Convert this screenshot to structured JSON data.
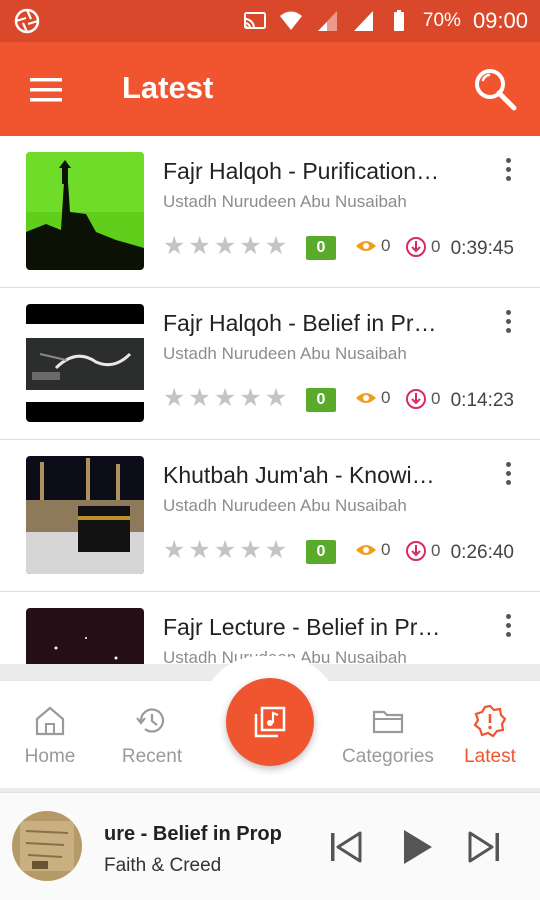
{
  "status_bar": {
    "battery": "70%",
    "time": "09:00"
  },
  "appbar": {
    "title": "Latest"
  },
  "items": [
    {
      "title": "Fajr Halqoh - Purification…",
      "author": "Ustadh Nurudeen Abu Nusaibah",
      "rating_badge": "0",
      "views": "0",
      "downloads": "0",
      "duration": "0:39:45"
    },
    {
      "title": "Fajr Halqoh - Belief in Pr…",
      "author": "Ustadh Nurudeen Abu Nusaibah",
      "rating_badge": "0",
      "views": "0",
      "downloads": "0",
      "duration": "0:14:23"
    },
    {
      "title": "Khutbah Jum'ah - Knowi…",
      "author": "Ustadh Nurudeen Abu Nusaibah",
      "rating_badge": "0",
      "views": "0",
      "downloads": "0",
      "duration": "0:26:40"
    },
    {
      "title": "Fajr Lecture - Belief in Pr…",
      "author": "Ustadh Nurudeen Abu Nusaibah"
    }
  ],
  "nav": {
    "home": "Home",
    "recent": "Recent",
    "categories": "Categories",
    "latest": "Latest"
  },
  "player": {
    "title": "ure - Belief in Prop",
    "subtitle": "Faith & Creed"
  },
  "colors": {
    "accent": "#f0552f",
    "status_bar": "#d9482b",
    "badge_green": "#5aab2c",
    "views_orange": "#f0a020",
    "downloads_pink": "#d8286a"
  },
  "icons": {
    "stars_per_item": 5
  }
}
